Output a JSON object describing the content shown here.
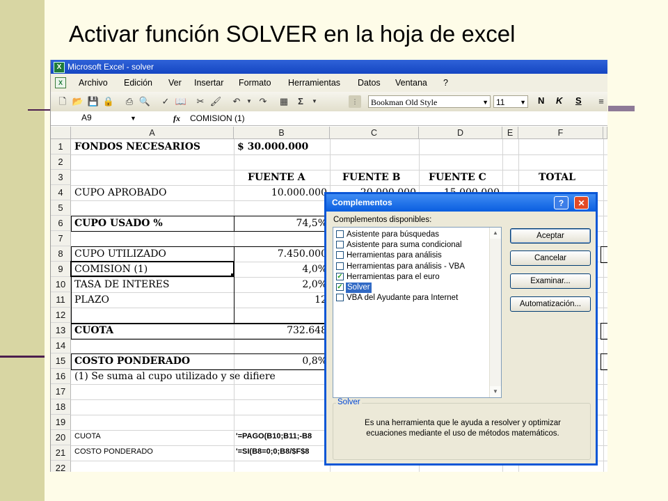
{
  "slide": {
    "title": "Activar función SOLVER en la hoja de excel"
  },
  "window": {
    "title": "Microsoft Excel - solver"
  },
  "menu": [
    "Archivo",
    "Edición",
    "Ver",
    "Insertar",
    "Formato",
    "Herramientas",
    "Datos",
    "Ventana",
    "?"
  ],
  "toolbar": {
    "font": "Bookman Old Style",
    "size": "11",
    "bold": "N",
    "italic": "K",
    "underline": "S",
    "sigma": "Σ"
  },
  "formula_bar": {
    "name_box": "A9",
    "fx": "fx",
    "value": "COMISION (1)"
  },
  "columns": [
    "A",
    "B",
    "C",
    "D",
    "E",
    "F"
  ],
  "rows": [
    "1",
    "2",
    "3",
    "4",
    "5",
    "6",
    "7",
    "8",
    "9",
    "10",
    "11",
    "12",
    "13",
    "14",
    "15",
    "16",
    "17",
    "18",
    "19",
    "20",
    "21",
    "22"
  ],
  "cells": {
    "a1": "FONDOS NECESARIOS",
    "b1": "$ 30.000.000",
    "b3": "FUENTE A",
    "c3": "FUENTE B",
    "d3": "FUENTE C",
    "f3": "TOTAL",
    "a4": "CUPO APROBADO",
    "b4": "10.000.000",
    "c4": "20.000.000",
    "d4": "15.000.000",
    "a6": "CUPO USADO %",
    "b6": "74,5%",
    "a8": "CUPO UTILIZADO",
    "b8": "7.450.000",
    "a9": "COMISION (1)",
    "b9": "4,0%",
    "a10": "TASA DE INTERES",
    "b10": "2,0%",
    "a11": "PLAZO",
    "b11": "12",
    "a13": "CUOTA",
    "b13": "732.648",
    "a15": "COSTO PONDERADO",
    "b15": "0,8%",
    "a16": "(1) Se suma al cupo utilizado y se difiere",
    "a20": "CUOTA",
    "b20": "'=PAGO(B10;B11;-B8",
    "a21": "COSTO PONDERADO",
    "b21": "'=SI(B8=0;0;B8/$F$8"
  },
  "dialog": {
    "title": "Complementos",
    "help": "?",
    "close": "✕",
    "list_label": "Complementos disponibles:",
    "items": [
      {
        "label": "Asistente para búsquedas",
        "checked": false
      },
      {
        "label": "Asistente para suma condicional",
        "checked": false
      },
      {
        "label": "Herramientas para análisis",
        "checked": false
      },
      {
        "label": "Herramientas para análisis - VBA",
        "checked": false
      },
      {
        "label": "Herramientas para el euro",
        "checked": true
      },
      {
        "label": "Solver",
        "checked": true
      },
      {
        "label": "VBA del Ayudante para Internet",
        "checked": false
      }
    ],
    "buttons": {
      "accept": "Aceptar",
      "cancel": "Cancelar",
      "browse": "Examinar...",
      "automation": "Automatización..."
    },
    "group_title": "Solver",
    "description": "Es una herramienta que le ayuda a resolver y optimizar ecuaciones mediante el uso de métodos matemáticos."
  }
}
